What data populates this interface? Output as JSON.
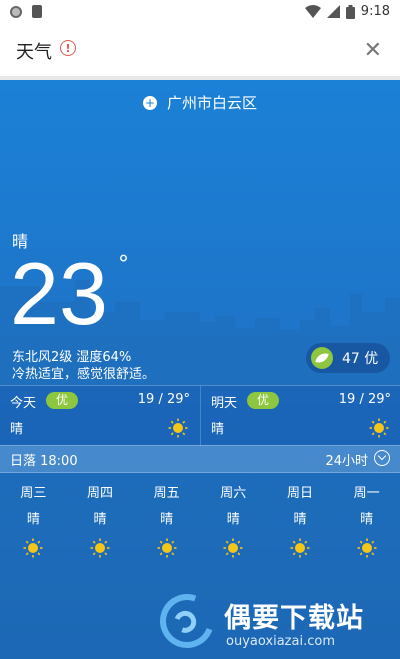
{
  "status_bar": {
    "time": "9:18"
  },
  "app_bar": {
    "title": "天气",
    "info_icon": "alert-icon",
    "close_icon": "close-icon"
  },
  "weather": {
    "location": "广州市白云区",
    "condition": "晴",
    "temperature": "23",
    "degree": "°",
    "wind_humidity": "东北风2级 湿度64%",
    "comfort": "冷热适宜，感觉很舒适。",
    "aqi": {
      "text": "47 优",
      "color": "#8dc63f"
    }
  },
  "today": {
    "label": "今天",
    "badge": "优",
    "range": "19 / 29°",
    "condition": "晴"
  },
  "tomorrow": {
    "label": "明天",
    "badge": "优",
    "range": "19 / 29°",
    "condition": "晴"
  },
  "sunset": {
    "text": "日落 18:00",
    "hourly_label": "24小时"
  },
  "week": [
    {
      "day": "周三",
      "cond": "晴"
    },
    {
      "day": "周四",
      "cond": "晴"
    },
    {
      "day": "周五",
      "cond": "晴"
    },
    {
      "day": "周六",
      "cond": "晴"
    },
    {
      "day": "周日",
      "cond": "晴"
    },
    {
      "day": "周一",
      "cond": "晴"
    }
  ],
  "watermark": {
    "name": "偶要下载站",
    "url": "ouyaoxiazai.com"
  },
  "colors": {
    "sky_top": "#1b81d6",
    "sky_bottom": "#1a62b2",
    "badge_green": "#8dc63f",
    "sun_yellow": "#f5c518"
  }
}
